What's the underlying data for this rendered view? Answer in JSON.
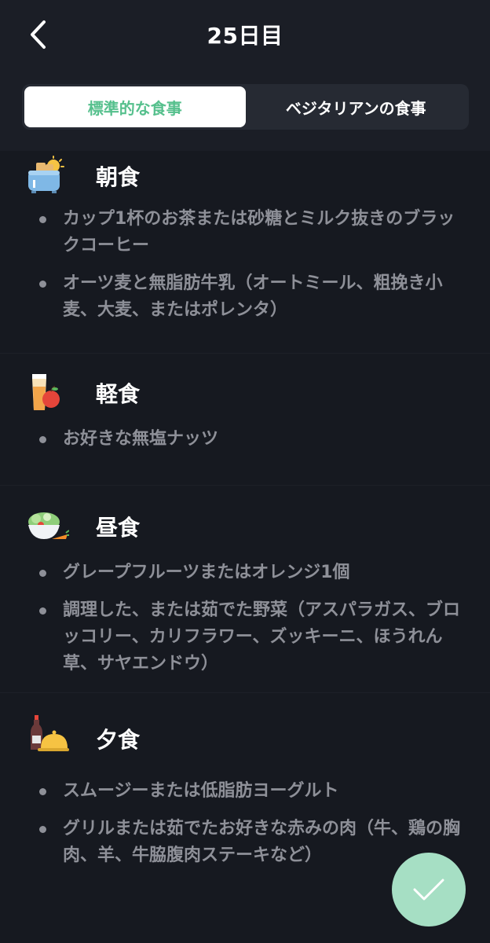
{
  "header": {
    "title": "25日目"
  },
  "tabs": [
    {
      "label": "標準的な食事",
      "active": true
    },
    {
      "label": "ベジタリアンの食事",
      "active": false
    }
  ],
  "sections": [
    {
      "title": "朝食",
      "icon": "toaster-icon",
      "items": [
        "カップ1杯のお茶または砂糖とミルク抜きのブラックコーヒー",
        "オーツ麦と無脂肪牛乳（オートミール、粗挽き小麦、大麦、またはポレンタ）"
      ]
    },
    {
      "title": "軽食",
      "icon": "juice-apple-icon",
      "items": [
        "お好きな無塩ナッツ"
      ]
    },
    {
      "title": "昼食",
      "icon": "salad-bowl-icon",
      "items": [
        "グレープフルーツまたはオレンジ1個",
        "調理した、または茹でた野菜（アスパラガス、ブロッコリー、カリフラワー、ズッキーニ、ほうれん草、サヤエンドウ）"
      ]
    },
    {
      "title": "夕食",
      "icon": "wine-cloche-icon",
      "items": [
        "スムージーまたは低脂肪ヨーグルト",
        "グリルまたは茹でたお好きな赤みの肉（牛、鶏の胸肉、羊、牛脇腹肉ステーキなど）"
      ]
    }
  ],
  "colors": {
    "accent": "#56c08d",
    "background": "#161920",
    "fab": "#a6dfc4",
    "muted_text": "#8e9098"
  }
}
